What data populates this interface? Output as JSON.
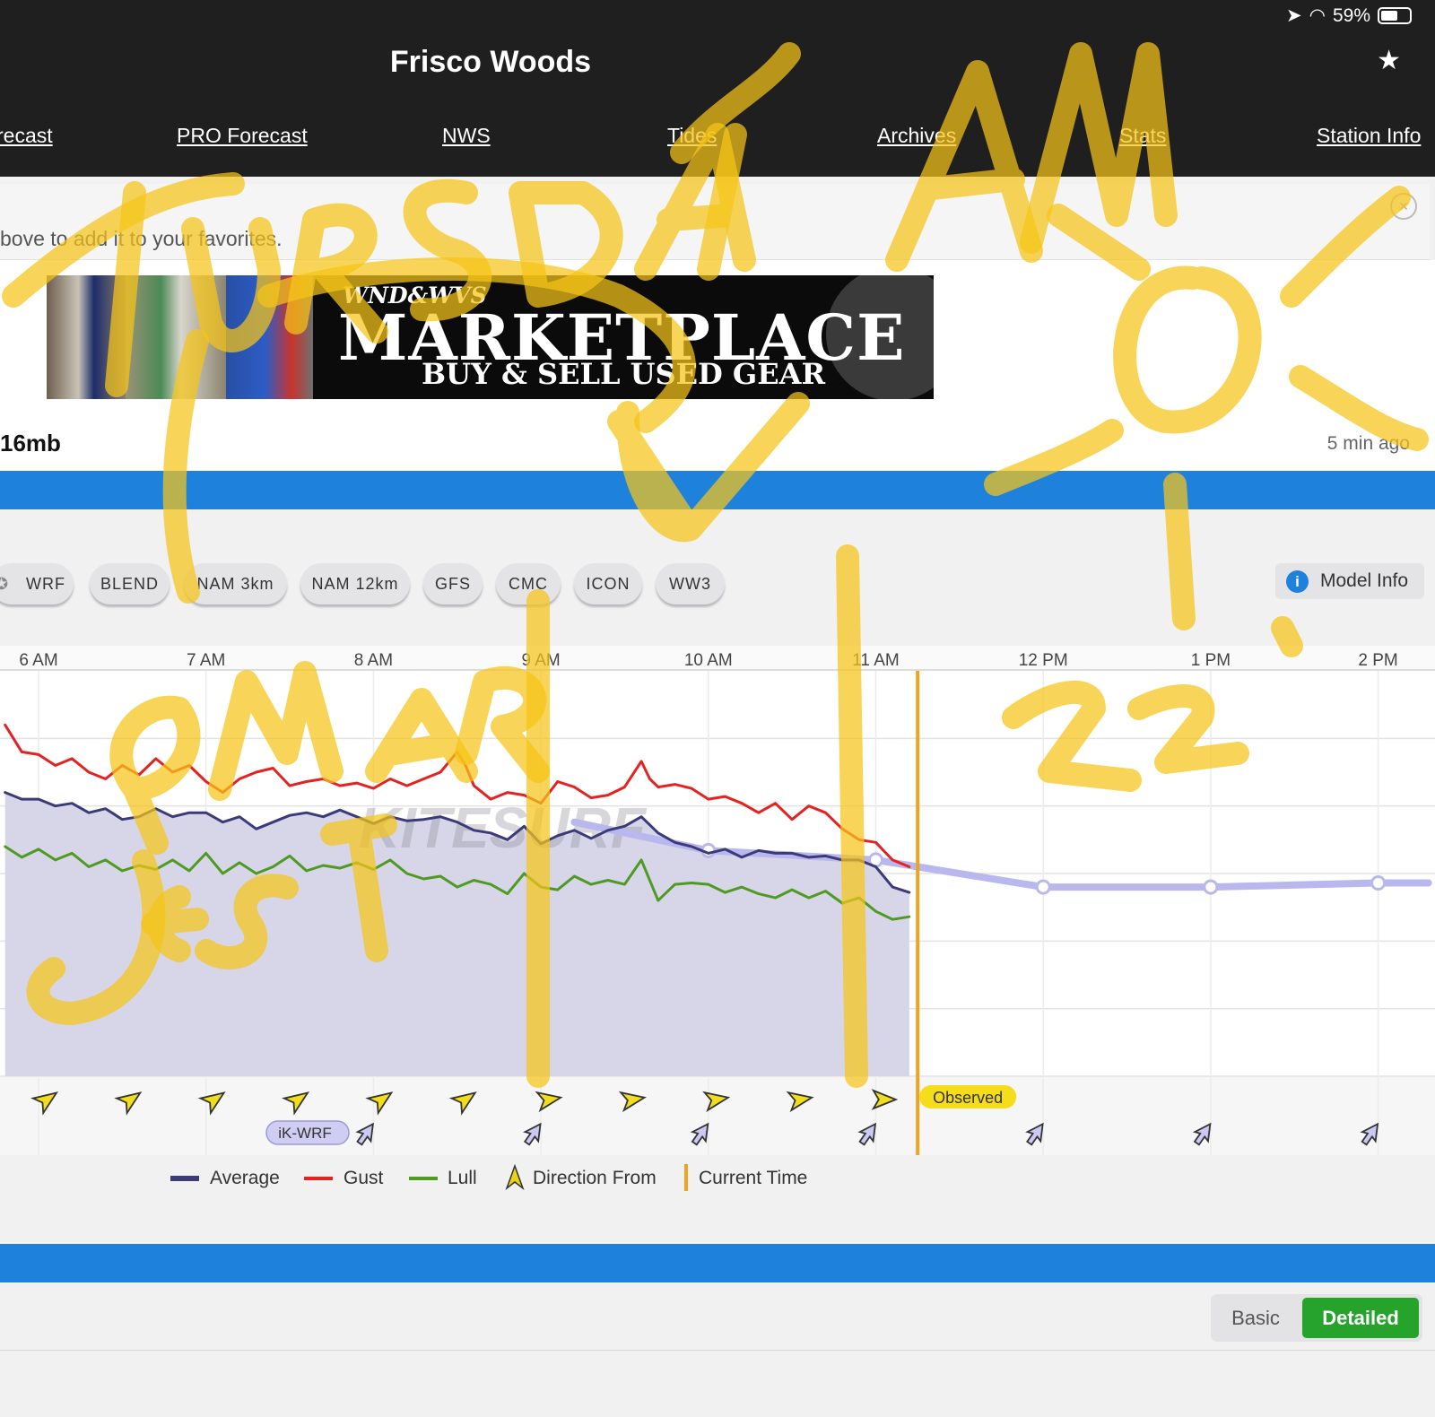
{
  "status": {
    "battery_text": "59%",
    "battery_level": 0.59
  },
  "header": {
    "title": "Frisco Woods",
    "star": "★"
  },
  "nav": [
    {
      "label": "recast"
    },
    {
      "label": "PRO Forecast"
    },
    {
      "label": "NWS"
    },
    {
      "label": "Tides"
    },
    {
      "label": "Archives"
    },
    {
      "label": "Stats"
    },
    {
      "label": "Station Info"
    }
  ],
  "favorites": {
    "text": "bove to add it to your favorites.",
    "close": "×"
  },
  "ad": {
    "brand": "WND&WVS",
    "headline": "MARKETPLACE",
    "sub": "BUY & SELL USED GEAR"
  },
  "info": {
    "pressure": "16mb",
    "updated": "5 min ago"
  },
  "models": [
    {
      "label": "WRF"
    },
    {
      "label": "BLEND"
    },
    {
      "label": "NAM 3km"
    },
    {
      "label": "NAM 12km"
    },
    {
      "label": "GFS"
    },
    {
      "label": "CMC"
    },
    {
      "label": "ICON"
    },
    {
      "label": "WW3"
    }
  ],
  "model_info": {
    "label": "Model Info",
    "icon": "i"
  },
  "chart_data": {
    "type": "line",
    "x_ticks": [
      "6 AM",
      "7 AM",
      "8 AM",
      "9 AM",
      "10 AM",
      "11 AM",
      "12 PM",
      "1 PM",
      "2 PM"
    ],
    "xlim": [
      5.8,
      14.3
    ],
    "ylim": [
      0,
      30
    ],
    "ygrid": [
      0,
      5,
      10,
      15,
      20,
      25
    ],
    "current_time": 11.25,
    "current_time_label": "Observed",
    "model_label": "iK-WRF",
    "watermark": "KITESURF",
    "series": [
      {
        "name": "Gust",
        "color": "#e52222",
        "x": [
          5.8,
          5.9,
          6.0,
          6.1,
          6.2,
          6.3,
          6.4,
          6.5,
          6.6,
          6.7,
          6.8,
          6.9,
          7.0,
          7.1,
          7.2,
          7.3,
          7.4,
          7.5,
          7.6,
          7.7,
          7.8,
          7.9,
          8.0,
          8.1,
          8.2,
          8.3,
          8.4,
          8.5,
          8.55,
          8.6,
          8.7,
          8.8,
          8.9,
          9.0,
          9.1,
          9.2,
          9.3,
          9.4,
          9.5,
          9.6,
          9.65,
          9.7,
          9.8,
          9.9,
          10.0,
          10.1,
          10.2,
          10.3,
          10.4,
          10.5,
          10.6,
          10.7,
          10.8,
          10.9,
          11.0,
          11.1,
          11.2
        ],
        "y": [
          26,
          24,
          23.8,
          23,
          23.5,
          22.5,
          22,
          23,
          22.3,
          23.5,
          22.5,
          23,
          21.8,
          21,
          22,
          22.5,
          22.8,
          21.5,
          21.8,
          22,
          21.5,
          21.7,
          21.3,
          22,
          21.5,
          22,
          22.5,
          24,
          23,
          21.5,
          20.5,
          21,
          20.8,
          20.2,
          21.8,
          21.4,
          20.6,
          20.8,
          21.4,
          23.3,
          22,
          21.4,
          21.6,
          21.3,
          20.5,
          20.7,
          20.2,
          19.5,
          20.2,
          19,
          20,
          19.5,
          18.3,
          17.5,
          17.3,
          16,
          15.5
        ]
      },
      {
        "name": "Average",
        "color": "#3b3b7a",
        "x": [
          5.8,
          5.9,
          6.0,
          6.1,
          6.2,
          6.3,
          6.4,
          6.5,
          6.6,
          6.7,
          6.8,
          6.9,
          7.0,
          7.1,
          7.2,
          7.3,
          7.4,
          7.5,
          7.6,
          7.7,
          7.8,
          7.9,
          8.0,
          8.1,
          8.2,
          8.3,
          8.4,
          8.5,
          8.6,
          8.7,
          8.8,
          8.9,
          9.0,
          9.1,
          9.2,
          9.3,
          9.4,
          9.5,
          9.6,
          9.7,
          9.8,
          9.9,
          10.0,
          10.1,
          10.2,
          10.3,
          10.4,
          10.5,
          10.6,
          10.7,
          10.8,
          10.9,
          11.0,
          11.1,
          11.2
        ],
        "y": [
          21,
          20.5,
          20.5,
          20,
          20.2,
          19.5,
          19.8,
          19,
          19.2,
          19.8,
          19.2,
          19.5,
          19.5,
          18.8,
          19.2,
          18.3,
          18.8,
          19.3,
          19.5,
          19.2,
          19.7,
          19.2,
          18.7,
          19.2,
          18.9,
          19,
          19.2,
          18.8,
          18.2,
          18,
          17.5,
          18.5,
          17.2,
          17.8,
          18.2,
          17.6,
          18.2,
          18.5,
          19.2,
          18,
          17.3,
          17,
          16.5,
          16.8,
          16.2,
          16.7,
          16.5,
          16.5,
          16.2,
          16.3,
          16,
          16,
          15.5,
          14,
          13.6
        ]
      },
      {
        "name": "Lull",
        "color": "#4f9a22",
        "x": [
          5.8,
          5.9,
          6.0,
          6.1,
          6.2,
          6.3,
          6.4,
          6.5,
          6.6,
          6.7,
          6.8,
          6.9,
          7.0,
          7.1,
          7.2,
          7.3,
          7.4,
          7.5,
          7.6,
          7.7,
          7.8,
          7.9,
          8.0,
          8.1,
          8.2,
          8.3,
          8.4,
          8.5,
          8.6,
          8.7,
          8.8,
          8.9,
          9.0,
          9.1,
          9.2,
          9.3,
          9.4,
          9.5,
          9.6,
          9.7,
          9.8,
          9.9,
          10.0,
          10.1,
          10.2,
          10.3,
          10.4,
          10.5,
          10.6,
          10.7,
          10.8,
          10.9,
          11.0,
          11.1,
          11.2
        ],
        "y": [
          17,
          16.2,
          16.8,
          16,
          16.5,
          15.5,
          16,
          15.2,
          15.6,
          15.3,
          16,
          15.2,
          16.5,
          15,
          15.8,
          15,
          15.5,
          16.3,
          15.2,
          15.6,
          15.4,
          15.8,
          15.3,
          16,
          15,
          14.6,
          14.8,
          14,
          14.5,
          14.2,
          13.5,
          15,
          14,
          13.8,
          14.8,
          14.2,
          14.5,
          14.2,
          16,
          13,
          14.2,
          14.3,
          14.2,
          13.6,
          14,
          13.5,
          13.2,
          13.8,
          13.2,
          13.7,
          12.8,
          13.2,
          12.2,
          11.6,
          11.8
        ]
      },
      {
        "name": "Forecast",
        "color": "#b9b8ee",
        "x": [
          9.2,
          10.0,
          11.0,
          12.0,
          13.0,
          14.0,
          14.3
        ],
        "y": [
          18.8,
          16.7,
          16.0,
          14.0,
          14.0,
          14.3,
          14.3
        ]
      }
    ],
    "obs_arrows_x": [
      6.05,
      6.55,
      7.05,
      7.55,
      8.05,
      8.55,
      9.05,
      9.55,
      10.05,
      10.55,
      11.05
    ],
    "model_arrows_x": [
      8.0,
      9.0,
      10.0,
      11.0,
      12.0,
      13.0,
      14.0
    ]
  },
  "legend": [
    {
      "label": "Average",
      "color": "#3b3b7a"
    },
    {
      "label": "Gust",
      "color": "#e52222"
    },
    {
      "label": "Lull",
      "color": "#4f9a22"
    },
    {
      "label": "Direction From",
      "color": "#e8d318"
    },
    {
      "label": "Current Time",
      "color": "#f0a322"
    }
  ],
  "view_toggle": {
    "basic": "Basic",
    "detailed": "Detailed"
  }
}
